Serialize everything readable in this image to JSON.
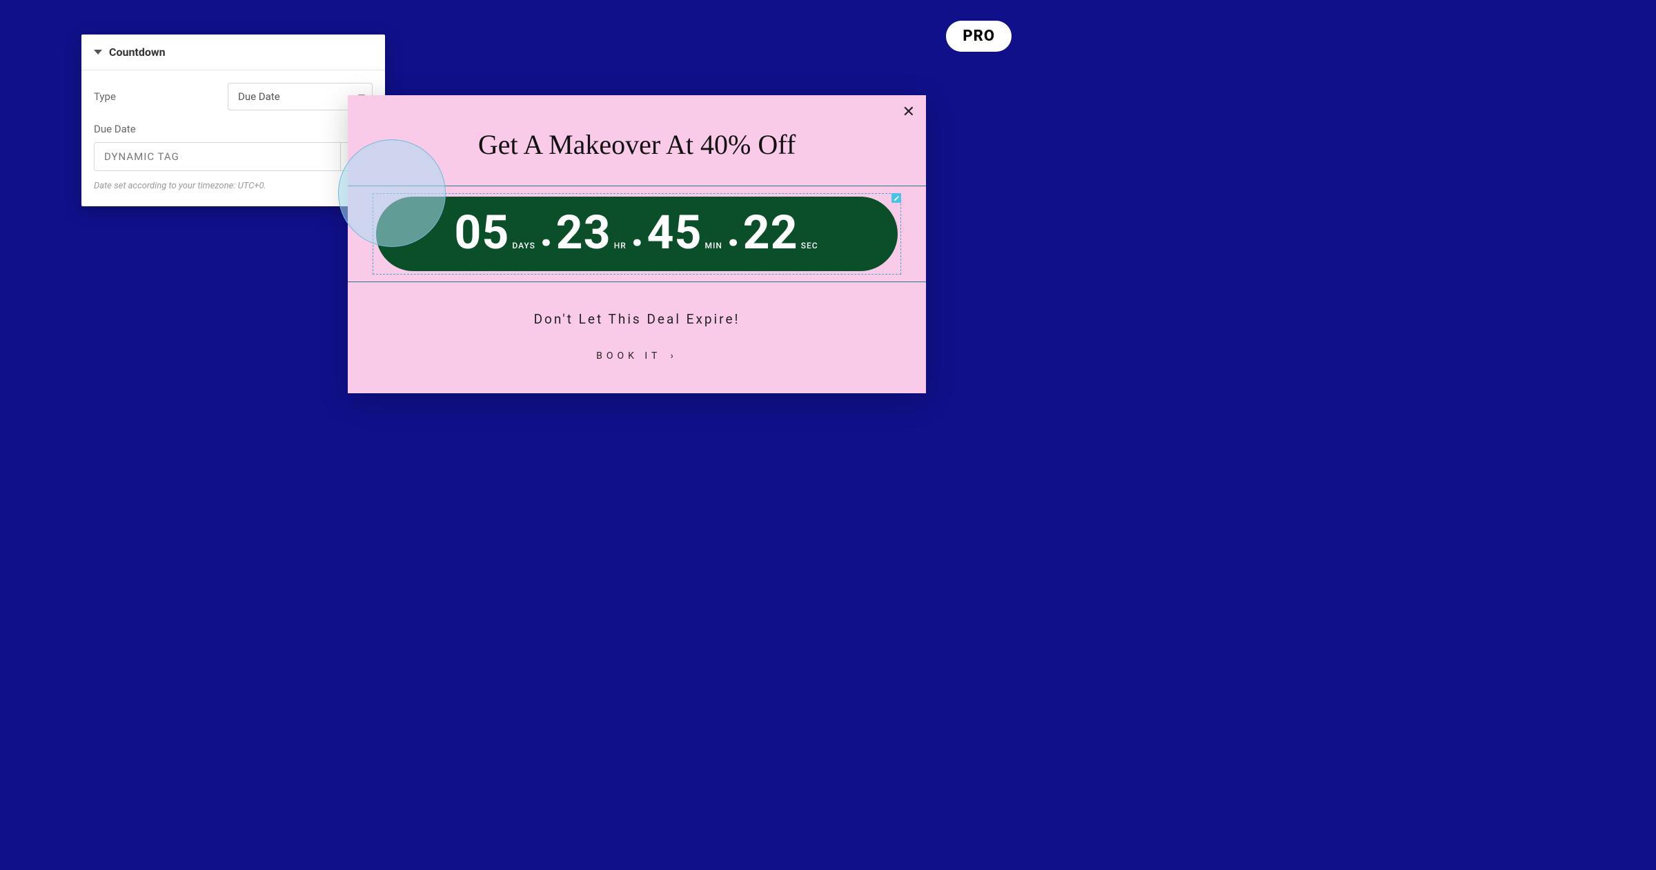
{
  "badge": {
    "label": "PRO"
  },
  "panel": {
    "title": "Countdown",
    "type_label": "Type",
    "type_value": "Due Date",
    "due_date_label": "Due Date",
    "due_date_value": "DYNAMIC TAG",
    "hint": "Date set according to your timezone: UTC+0."
  },
  "popup": {
    "title": "Get A Makeover At 40% Off",
    "countdown": {
      "days": {
        "value": "05",
        "unit": "DAYS"
      },
      "hours": {
        "value": "23",
        "unit": "HR"
      },
      "minutes": {
        "value": "45",
        "unit": "MIN"
      },
      "seconds": {
        "value": "22",
        "unit": "SEC"
      }
    },
    "subhead": "Don't Let This Deal Expire!",
    "cta": "BOOK IT"
  }
}
